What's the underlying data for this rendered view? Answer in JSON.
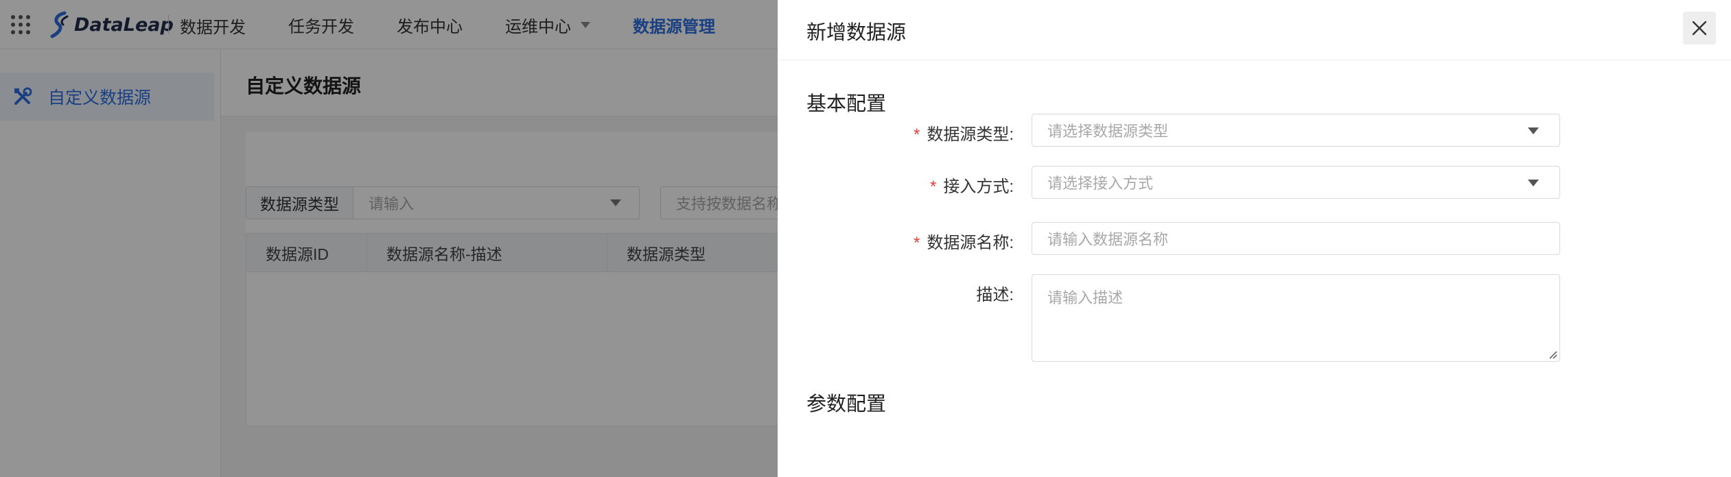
{
  "app": {
    "logo_text": "DataLeap",
    "product_name": "数据开发",
    "nav": [
      {
        "label": "任务开发"
      },
      {
        "label": "发布中心"
      },
      {
        "label": "运维中心"
      },
      {
        "label": "数据源管理"
      }
    ],
    "accent_color": "#2f6fe0"
  },
  "sidebar": {
    "items": [
      {
        "label": "自定义数据源",
        "icon": "tools-icon"
      }
    ]
  },
  "page": {
    "title": "自定义数据源",
    "filter_type_label": "数据源类型",
    "filter_type_placeholder": "请输入",
    "filter_search_placeholder": "支持按数据名称",
    "table_columns": [
      "数据源ID",
      "数据源名称-描述",
      "数据源类型"
    ]
  },
  "drawer": {
    "title": "新增数据源",
    "section_basic": "基本配置",
    "section_params": "参数配置",
    "fields": {
      "type": {
        "label": "数据源类型:",
        "placeholder": "请选择数据源类型",
        "required": true
      },
      "access": {
        "label": "接入方式:",
        "placeholder": "请选择接入方式",
        "required": true
      },
      "name": {
        "label": "数据源名称:",
        "placeholder": "请输入数据源名称",
        "required": true
      },
      "desc": {
        "label": "描述:",
        "placeholder": "请输入描述",
        "required": false
      }
    },
    "required_mark": "*"
  }
}
